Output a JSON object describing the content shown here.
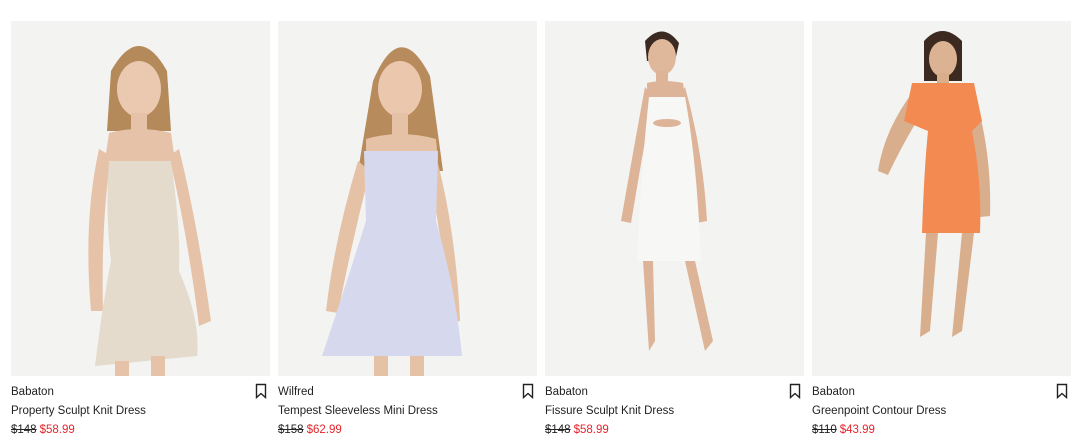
{
  "products": [
    {
      "brand": "Babaton",
      "name": "Property Sculpt Knit Dress",
      "old_price": "$148",
      "sale_price": "$58.99",
      "dress_color": "#e4dbcc",
      "bookmark_icon": "bookmark-icon"
    },
    {
      "brand": "Wilfred",
      "name": "Tempest Sleeveless Mini Dress",
      "old_price": "$158",
      "sale_price": "$62.99",
      "dress_color": "#d6d9ee",
      "bookmark_icon": "bookmark-icon"
    },
    {
      "brand": "Babaton",
      "name": "Fissure Sculpt Knit Dress",
      "old_price": "$148",
      "sale_price": "$58.99",
      "dress_color": "#f7f7f5",
      "bookmark_icon": "bookmark-icon"
    },
    {
      "brand": "Babaton",
      "name": "Greenpoint Contour Dress",
      "old_price": "$110",
      "sale_price": "$43.99",
      "dress_color": "#f28a52",
      "bookmark_icon": "bookmark-icon"
    }
  ],
  "colors": {
    "sale": "#e4252c",
    "image_bg": "#f3f3f2"
  }
}
